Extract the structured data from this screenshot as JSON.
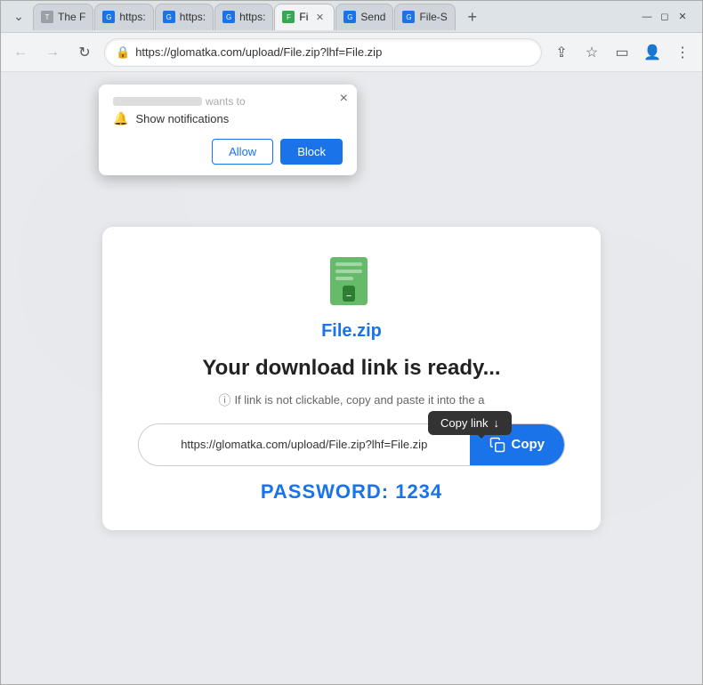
{
  "browser": {
    "tabs": [
      {
        "id": "tab1",
        "favicon_type": "gray",
        "favicon_letter": "T",
        "title": "The F",
        "active": false,
        "closable": false
      },
      {
        "id": "tab2",
        "favicon_type": "blue2",
        "favicon_letter": "G",
        "title": "https:",
        "active": false,
        "closable": false
      },
      {
        "id": "tab3",
        "favicon_type": "blue2",
        "favicon_letter": "G",
        "title": "https:",
        "active": false,
        "closable": false
      },
      {
        "id": "tab4",
        "favicon_type": "blue2",
        "favicon_letter": "G",
        "title": "https:",
        "active": false,
        "closable": false
      },
      {
        "id": "tab5",
        "favicon_type": "green",
        "favicon_letter": "F",
        "title": "Fi",
        "active": true,
        "closable": true
      },
      {
        "id": "tab6",
        "favicon_type": "blue2",
        "favicon_letter": "G",
        "title": "Send",
        "active": false,
        "closable": false
      },
      {
        "id": "tab7",
        "favicon_type": "blue2",
        "favicon_letter": "G",
        "title": "File-S",
        "active": false,
        "closable": false
      }
    ],
    "address": "https://glomatka.com/upload/File.zip?lhf=File.zip",
    "new_tab_label": "+"
  },
  "notification_popup": {
    "site_blurred": true,
    "wants_text": "wants to",
    "permission_label": "Show notifications",
    "allow_label": "Allow",
    "block_label": "Block",
    "close_symbol": "×"
  },
  "page": {
    "file_name": "File.zip",
    "download_heading": "Your download link is ready...",
    "info_text": "If link is not clickable, copy and paste it into the a",
    "link_url": "https://glomatka.com/upload/File.zip?lhf=File.zip",
    "copy_button_label": "Copy",
    "copy_link_tooltip": "Copy link",
    "copy_link_arrow": "↓",
    "password_label": "PASSWORD: 1234"
  }
}
